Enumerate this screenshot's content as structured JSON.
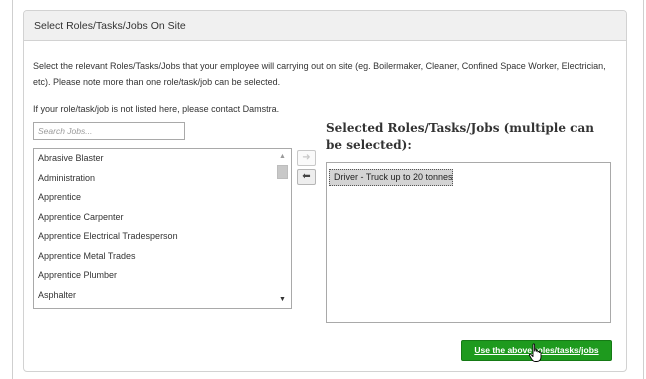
{
  "panel": {
    "title": "Select Roles/Tasks/Jobs On Site",
    "description": "Select the relevant Roles/Tasks/Jobs that your employee will carrying out on site (eg. Boilermaker, Cleaner, Confined Space Worker, Electrician, etc). Please note more than one role/task/job can be selected.",
    "contact_note": "If your role/task/job is not listed here, please contact Damstra."
  },
  "search": {
    "placeholder": "Search Jobs...",
    "value": ""
  },
  "job_list": {
    "items": [
      "Abrasive Blaster",
      "Administration",
      "Apprentice",
      "Apprentice Carpenter",
      "Apprentice Electrical Tradesperson",
      "Apprentice Metal Trades",
      "Apprentice Plumber",
      "Asphalter"
    ]
  },
  "transfer": {
    "add_icon": "arrow-right-icon",
    "remove_icon": "arrow-left-icon",
    "add_glyph": "➜",
    "remove_glyph": "⬅"
  },
  "selected": {
    "heading": "Selected Roles/Tasks/Jobs (multiple can be selected):",
    "items": [
      "Driver - Truck up to 20 tonnes"
    ]
  },
  "actions": {
    "confirm_label": "Use the above roles/tasks/jobs"
  },
  "colors": {
    "confirm_button": "#1e9a1e",
    "header_bg": "#f0f0f0"
  }
}
